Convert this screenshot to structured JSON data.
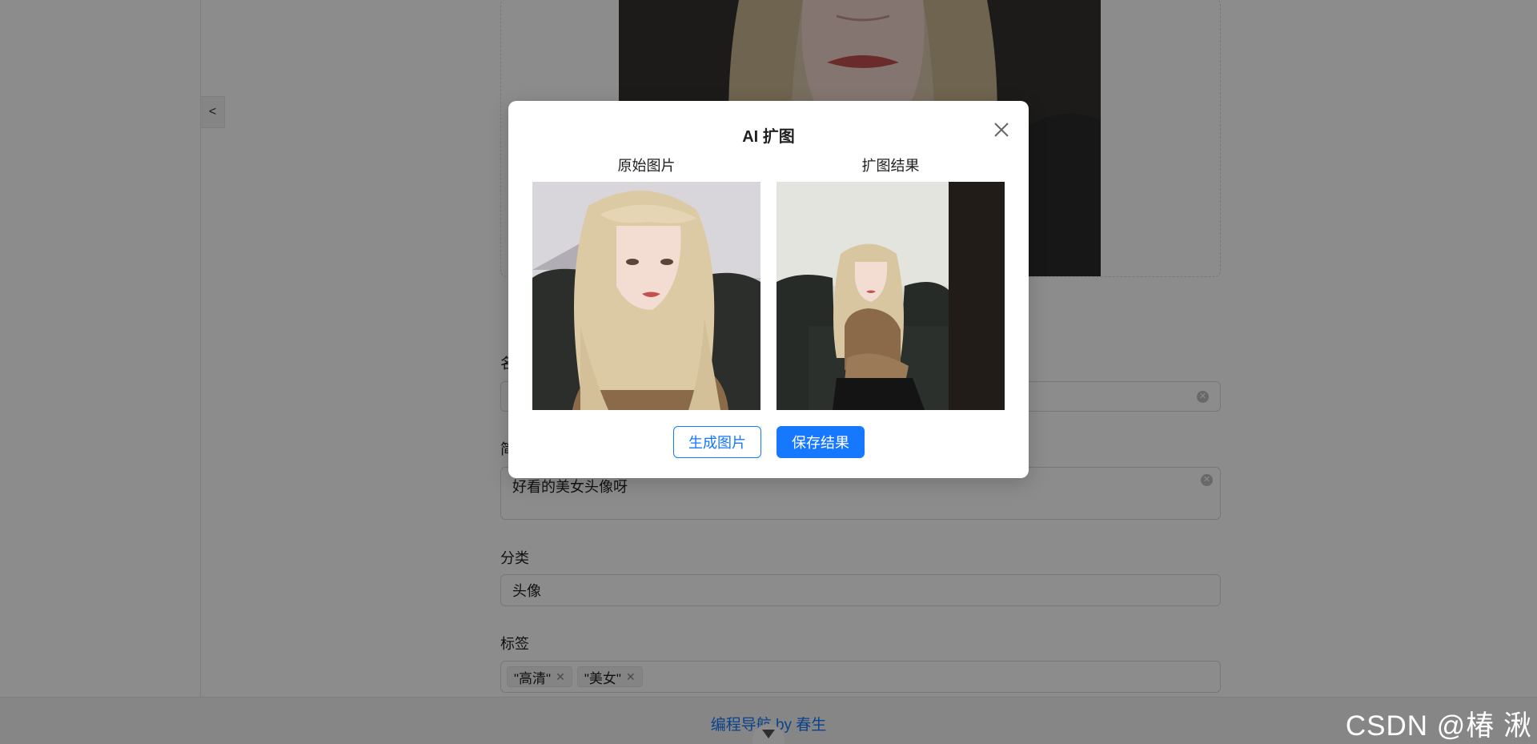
{
  "form": {
    "name_label": "名称",
    "desc_label": "简介",
    "desc_value": "好看的美女头像呀",
    "category_label": "分类",
    "category_value": "头像",
    "tags_label": "标签",
    "tags": [
      "\"高清\"",
      "\"美女\""
    ]
  },
  "sidebar": {
    "collapse_label": "<"
  },
  "footer": {
    "link": "编程导航 by 春生"
  },
  "watermark": "CSDN @椿  湫",
  "modal": {
    "title": "AI 扩图",
    "original_label": "原始图片",
    "result_label": "扩图结果",
    "generate_button": "生成图片",
    "save_button": "保存结果"
  },
  "colors": {
    "primary": "#1677ff",
    "mask": "rgba(0,0,0,0.45)"
  }
}
